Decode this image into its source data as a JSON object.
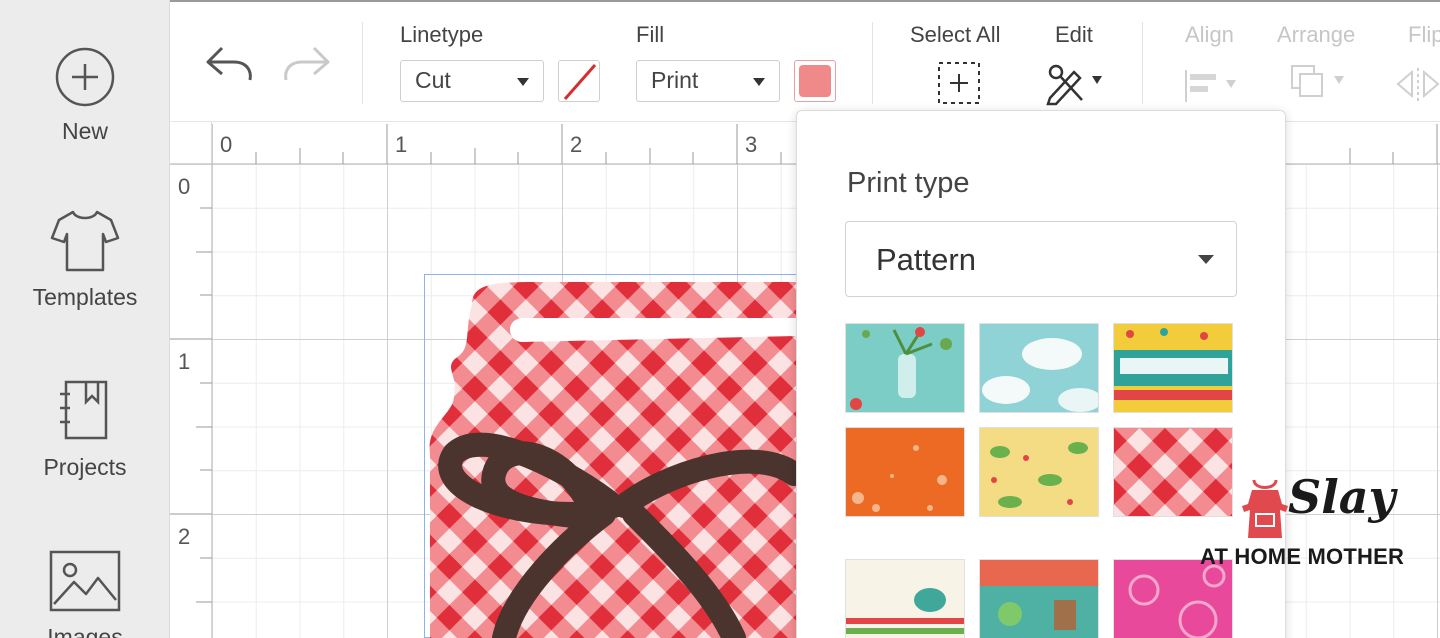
{
  "sidebar": {
    "items": [
      {
        "label": "New",
        "icon": "plus-circle-icon"
      },
      {
        "label": "Templates",
        "icon": "tshirt-icon"
      },
      {
        "label": "Projects",
        "icon": "notebook-icon"
      },
      {
        "label": "Images",
        "icon": "image-icon"
      }
    ]
  },
  "toolbar": {
    "undo_icon": "undo-icon",
    "redo_icon": "redo-icon",
    "linetype": {
      "label": "Linetype",
      "value": "Cut"
    },
    "fill": {
      "label": "Fill",
      "value": "Print"
    },
    "select_all_label": "Select All",
    "edit_label": "Edit",
    "align_label": "Align",
    "arrange_label": "Arrange",
    "flip_label": "Flip"
  },
  "ruler": {
    "top": [
      "0",
      "1",
      "2",
      "3"
    ],
    "left": [
      "0",
      "1",
      "2"
    ]
  },
  "popup": {
    "title": "Print type",
    "selected": "Pattern",
    "patterns": [
      "floral-teal-pattern",
      "clouds-blue-pattern",
      "text-cloud-pattern",
      "orange-speckle-pattern",
      "yellow-floral-pattern",
      "red-gingham-pattern",
      "bird-stripe-pattern",
      "teal-scene-pattern",
      "pink-floral-pattern"
    ]
  },
  "watermark": {
    "brand": "Slay",
    "tagline": "AT HOME MOTHER"
  },
  "colors": {
    "accent_red": "#e04a4e",
    "gingham_red": "#e8434c",
    "bow_brown": "#4a342d",
    "selection_blue": "#8fb3e6"
  }
}
